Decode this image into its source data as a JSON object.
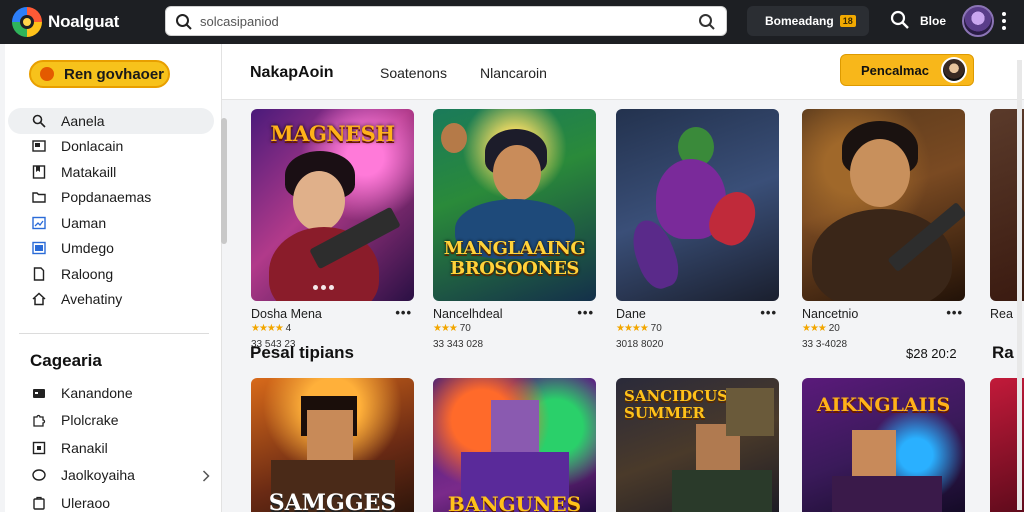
{
  "topbar": {
    "brand": "Noalguat",
    "search_placeholder": "solcasipaniod",
    "button_label": "Bomeadang",
    "button_badge": "18",
    "user_label": "Bloe"
  },
  "sidebar": {
    "cta_label": "Ren govhaoer",
    "nav": [
      {
        "label": "Aanela",
        "icon": "search-icon"
      },
      {
        "label": "Donlacain",
        "icon": "library-icon"
      },
      {
        "label": "Matakaill",
        "icon": "bookmark-icon"
      },
      {
        "label": "Popdanaemas",
        "icon": "folder-icon"
      },
      {
        "label": "Uaman",
        "icon": "image-icon"
      },
      {
        "label": "Umdego",
        "icon": "gallery-icon"
      },
      {
        "label": "Raloong",
        "icon": "document-icon"
      },
      {
        "label": "Avehatiny",
        "icon": "home-icon"
      }
    ],
    "categories_title": "Cagearia",
    "categories": [
      {
        "label": "Kanandone",
        "icon": "gamepad-icon"
      },
      {
        "label": "Plolcrake",
        "icon": "puzzle-icon"
      },
      {
        "label": "Ranakil",
        "icon": "square-icon"
      },
      {
        "label": "Jaolkoyaiha",
        "icon": "circle-icon"
      },
      {
        "label": "Uleraoo",
        "icon": "bag-icon"
      }
    ]
  },
  "main": {
    "title": "NakapAoin",
    "tabs": [
      "Soatenons",
      "Nlancaroin"
    ],
    "cta_label": "Pencalmac",
    "cards": [
      {
        "name": "Dosha Mena",
        "rating": "4",
        "count": "33 543 23",
        "art_title": "MAGNESH"
      },
      {
        "name": "Nancelhdeal",
        "rating": "70",
        "count": "33 343 028",
        "art_title": "MANGLAAING BROSOONES"
      },
      {
        "name": "Dane",
        "rating": "70",
        "count": "3018 8020",
        "art_title": ""
      },
      {
        "name": "Nancetnio",
        "rating": "20",
        "count": "33 3-4028",
        "art_title": ""
      },
      {
        "name": "Rea"
      }
    ],
    "section_title": "Pesal tipians",
    "price": "$28 20:2",
    "section_title_right": "Ra",
    "row2": [
      {
        "art_title": "SAMGGES"
      },
      {
        "art_title": "BANGUNES"
      },
      {
        "art_title": "SANCIDCUS SUMMER"
      },
      {
        "art_title": "AIKNGLAIIS"
      }
    ]
  },
  "colors": {
    "topbar": "#1d1f23",
    "accent_yellow": "#f7c21b",
    "sidebar_bg": "#ffffff",
    "page_bg": "#f3f4f6"
  }
}
